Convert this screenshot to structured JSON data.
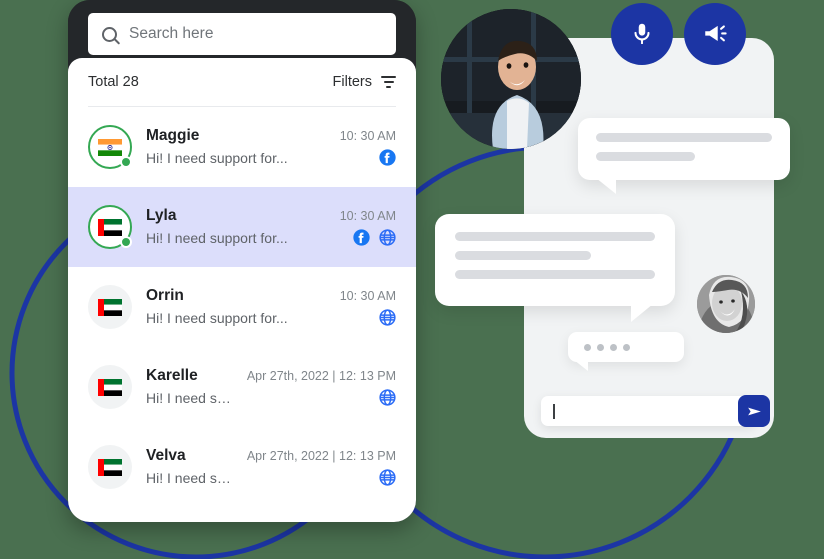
{
  "background": {
    "color": "#4a7050",
    "accent_blue": "#1c35a4",
    "selected_row": "#dcdefb"
  },
  "phone": {
    "search": {
      "icon": "search-icon",
      "placeholder": "Search here",
      "value": ""
    },
    "list_meta": {
      "total_label": "Total 28",
      "filters_label": "Filters",
      "filters_icon": "filter-icon"
    },
    "contacts": [
      {
        "name": "Maggie",
        "snippet": "Hi! I need support for...",
        "time": "10: 30 AM",
        "flag": "india-flag",
        "online": true,
        "selected": false,
        "channels": [
          "facebook-icon"
        ]
      },
      {
        "name": "Lyla",
        "snippet": "Hi! I need support for...",
        "time": "10: 30 AM",
        "flag": "uae-flag",
        "online": true,
        "selected": true,
        "channels": [
          "facebook-icon",
          "web-globe-icon"
        ]
      },
      {
        "name": "Orrin",
        "snippet": "Hi! I need support for...",
        "time": "10: 30 AM",
        "flag": "uae-flag",
        "online": false,
        "selected": false,
        "channels": [
          "web-globe-icon"
        ]
      },
      {
        "name": "Karelle",
        "snippet": "Hi! I need support for...",
        "time": "Apr 27th, 2022 | 12: 13 PM",
        "flag": "uae-flag",
        "online": false,
        "selected": false,
        "channels": [
          "web-globe-icon"
        ]
      },
      {
        "name": "Velva",
        "snippet": "Hi! I need support for...",
        "time": "Apr 27th, 2022 | 12: 13 PM",
        "flag": "uae-flag",
        "online": false,
        "selected": false,
        "channels": [
          "web-globe-icon"
        ]
      }
    ]
  },
  "chat": {
    "fabs": [
      {
        "name": "microphone-icon",
        "label": ""
      },
      {
        "name": "announcement-megaphone-icon",
        "label": ""
      }
    ],
    "outgoing_bubble": {
      "lines": 2,
      "text": ""
    },
    "incoming_bubble": {
      "lines": 3,
      "text": ""
    },
    "typing_indicator": {
      "dots": 4
    },
    "composer": {
      "value": "",
      "placeholder": "",
      "send_icon": "send-paper-plane-icon"
    },
    "avatars": [
      {
        "name": "agent-photo-avatar"
      },
      {
        "name": "customer-photo-avatar"
      }
    ]
  }
}
